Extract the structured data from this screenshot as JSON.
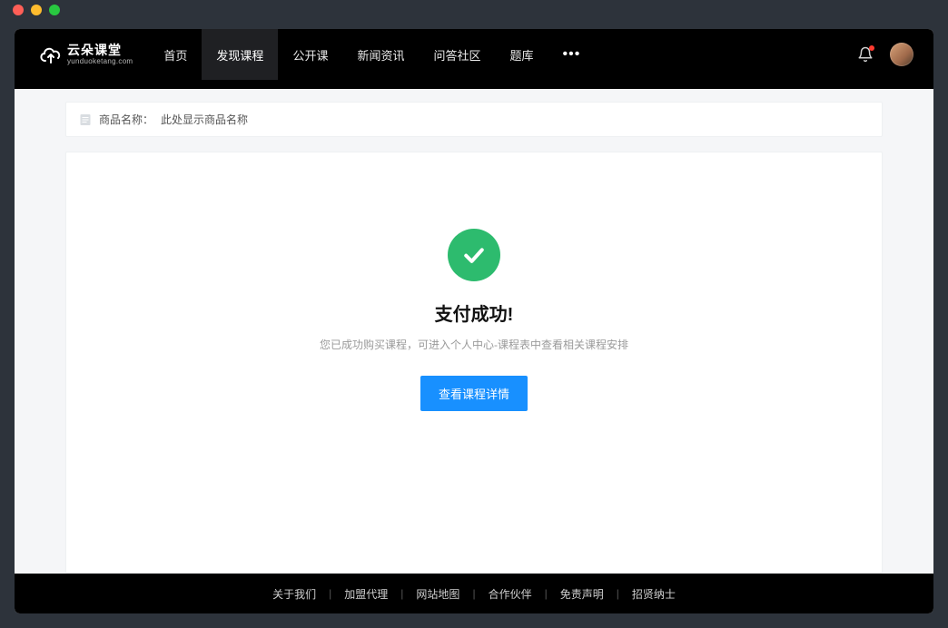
{
  "logo": {
    "text": "云朵课堂",
    "sub": "yunduoketang.com"
  },
  "nav": {
    "items": [
      {
        "label": "首页",
        "active": false
      },
      {
        "label": "发现课程",
        "active": true
      },
      {
        "label": "公开课",
        "active": false
      },
      {
        "label": "新闻资讯",
        "active": false
      },
      {
        "label": "问答社区",
        "active": false
      },
      {
        "label": "题库",
        "active": false
      }
    ],
    "more_glyph": "•••"
  },
  "header_icons": {
    "bell": "notification-bell-icon",
    "has_unread": true
  },
  "product_bar": {
    "label": "商品名称：",
    "value": "此处显示商品名称"
  },
  "success": {
    "title": "支付成功!",
    "desc": "您已成功购买课程，可进入个人中心-课程表中查看相关课程安排",
    "cta_label": "查看课程详情"
  },
  "footer": {
    "links": [
      "关于我们",
      "加盟代理",
      "网站地图",
      "合作伙伴",
      "免责声明",
      "招贤纳士"
    ]
  },
  "colors": {
    "accent_green": "#2dbb6e",
    "accent_blue": "#1890ff",
    "nav_bg": "#000000"
  }
}
